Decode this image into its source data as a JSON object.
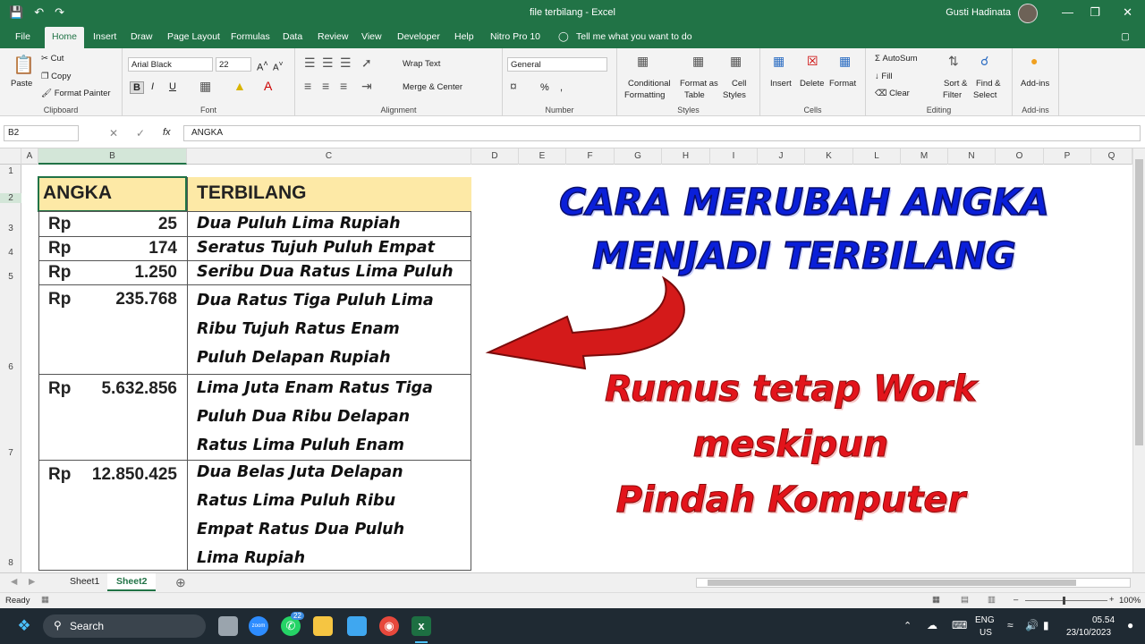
{
  "window": {
    "title": "file terbilang - Excel",
    "user": "Gusti Hadinata"
  },
  "qat": {
    "save": "💾",
    "undo": "↶",
    "redo": "↷"
  },
  "tabs": [
    "File",
    "Home",
    "Insert",
    "Draw",
    "Page Layout",
    "Formulas",
    "Data",
    "Review",
    "View",
    "Developer",
    "Help",
    "Nitro Pro 10"
  ],
  "tell_me": "Tell me what you want to do",
  "ribbon": {
    "clipboard": {
      "paste": "Paste",
      "cut": "Cut",
      "copy": "Copy",
      "format_painter": "Format Painter",
      "label": "Clipboard"
    },
    "font": {
      "name": "Arial Black",
      "size": "22",
      "bold": "B",
      "italic": "I",
      "underline": "U",
      "label": "Font"
    },
    "alignment": {
      "wrap": "Wrap Text",
      "merge": "Merge & Center",
      "label": "Alignment"
    },
    "number": {
      "format": "General",
      "percent": "%",
      "comma": ",",
      "label": "Number"
    },
    "styles": {
      "conditional": "Conditional",
      "conditional2": "Formatting",
      "format_as": "Format as",
      "format_as2": "Table",
      "cell": "Cell",
      "cell2": "Styles",
      "label": "Styles"
    },
    "cells": {
      "insert": "Insert",
      "delete": "Delete",
      "format": "Format",
      "label": "Cells"
    },
    "editing": {
      "autosum": "AutoSum",
      "fill": "Fill",
      "clear": "Clear",
      "sort": "Sort &",
      "sort2": "Filter",
      "find": "Find &",
      "find2": "Select",
      "label": "Editing"
    },
    "addins": {
      "addins": "Add-ins",
      "label": "Add-ins"
    }
  },
  "formula_bar": {
    "name_box": "B2",
    "fx": "fx",
    "content": "ANGKA"
  },
  "columns": [
    "A",
    "B",
    "C",
    "D",
    "E",
    "F",
    "G",
    "H",
    "I",
    "J",
    "K",
    "L",
    "M",
    "N",
    "O",
    "P",
    "Q"
  ],
  "rows": [
    "1",
    "2",
    "3",
    "4",
    "5",
    "6",
    "7",
    "8"
  ],
  "table": {
    "header_angka": "ANGKA",
    "header_terbilang": "TERBILANG",
    "rows": [
      {
        "rp": "Rp",
        "num": "25",
        "text": [
          "Dua Puluh Lima Rupiah"
        ]
      },
      {
        "rp": "Rp",
        "num": "174",
        "text": [
          "Seratus Tujuh Puluh Empat"
        ]
      },
      {
        "rp": "Rp",
        "num": "1.250",
        "text": [
          "Seribu Dua Ratus Lima Puluh"
        ]
      },
      {
        "rp": "Rp",
        "num": "235.768",
        "text": [
          "Dua Ratus Tiga Puluh Lima",
          "Ribu Tujuh Ratus Enam",
          "Puluh Delapan Rupiah"
        ]
      },
      {
        "rp": "Rp",
        "num": "5.632.856",
        "text": [
          "Lima Juta Enam Ratus Tiga",
          "Puluh Dua Ribu Delapan",
          "Ratus Lima Puluh Enam"
        ]
      },
      {
        "rp": "Rp",
        "num": "12.850.425",
        "text": [
          "Dua Belas Juta Delapan",
          "Ratus Lima Puluh Ribu",
          "Empat Ratus Dua Puluh",
          "Lima Rupiah"
        ]
      }
    ]
  },
  "overlay": {
    "title1": "CARA MERUBAH ANGKA",
    "title2": "MENJADI TERBILANG",
    "sub1": "Rumus tetap Work",
    "sub2": "meskipun",
    "sub3": "Pindah Komputer"
  },
  "sheets": [
    "Sheet1",
    "Sheet2"
  ],
  "status": {
    "ready": "Ready",
    "zoom": "100%"
  },
  "taskbar": {
    "search": "Search",
    "lang1": "ENG",
    "lang2": "US",
    "time": "05.54",
    "date": "23/10/2023",
    "badge": "22"
  }
}
